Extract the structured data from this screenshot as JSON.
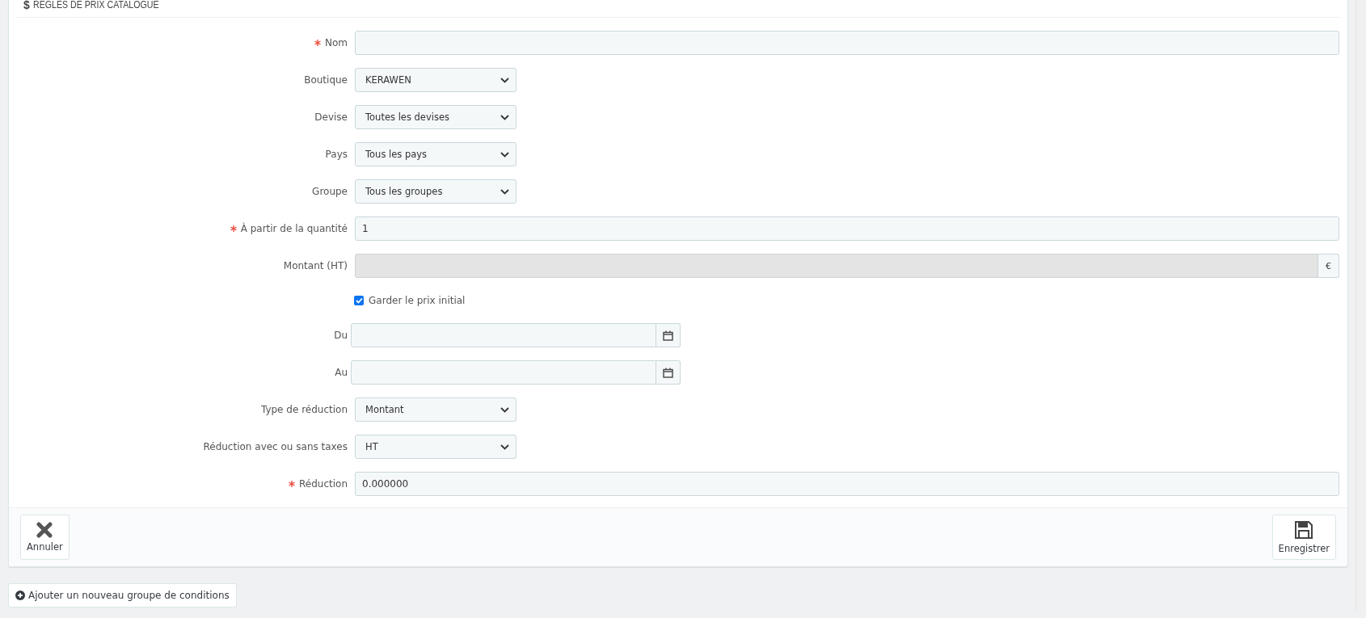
{
  "panel": {
    "heading_icon": "$",
    "title": "REGLES DE PRIX CATALOGUE"
  },
  "fields": [
    {
      "kind": "text",
      "label": "Nom",
      "required": true,
      "disabled": false
    },
    {
      "kind": "select",
      "label": "Boutique",
      "required": false,
      "value": "KERAWEN"
    },
    {
      "kind": "select",
      "label": "Devise",
      "required": false,
      "value": "Toutes les devises"
    },
    {
      "kind": "select",
      "label": "Pays",
      "required": false,
      "value": "Tous les pays"
    },
    {
      "kind": "select",
      "label": "Groupe",
      "required": false,
      "value": "Tous les groupes"
    },
    {
      "kind": "text",
      "label": "À partir de la quantité",
      "required": true,
      "disabled": false,
      "value": "1"
    },
    {
      "kind": "money",
      "label": "Montant (HT)",
      "required": false,
      "disabled": true,
      "addon": "€"
    },
    {
      "kind": "checkbox",
      "label": "Garder le prix initial",
      "checked": true
    },
    {
      "kind": "date",
      "label": "Du",
      "required": false
    },
    {
      "kind": "date",
      "label": "Au",
      "required": false
    },
    {
      "kind": "select",
      "label": "Type de réduction",
      "required": false,
      "value": "Montant"
    },
    {
      "kind": "select",
      "label": "Réduction avec ou sans taxes",
      "required": false,
      "value": "HT"
    },
    {
      "kind": "text",
      "label": "Réduction",
      "required": true,
      "disabled": false,
      "value": "0.000000"
    }
  ],
  "footer": {
    "cancel": "Annuler",
    "save": "Enregistrer"
  },
  "add_condition_group": "Ajouter un nouveau groupe de conditions"
}
